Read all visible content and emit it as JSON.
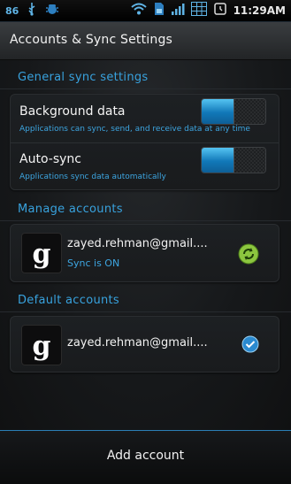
{
  "status_bar": {
    "battery_level": "86",
    "time": "11:29AM",
    "icons": [
      "usb-icon",
      "bug-icon",
      "wifi-icon",
      "sim-icon",
      "signal-icon",
      "grid-icon",
      "alarm-icon"
    ]
  },
  "header": {
    "title": "Accounts & Sync Settings"
  },
  "general": {
    "heading": "General sync settings",
    "background_data": {
      "title": "Background data",
      "subtitle": "Applications can sync, send, and receive data at any time",
      "enabled": true
    },
    "auto_sync": {
      "title": "Auto-sync",
      "subtitle": "Applications sync data automatically",
      "enabled": true
    }
  },
  "manage": {
    "heading": "Manage accounts",
    "account": {
      "email": "zayed.rehman@gmail....",
      "status": "Sync is ON"
    }
  },
  "defaults": {
    "heading": "Default accounts",
    "account": {
      "email": "zayed.rehman@gmail...."
    }
  },
  "footer": {
    "add_account": "Add account"
  },
  "colors": {
    "accent": "#38a2de",
    "sync_green": "#8cc63f"
  }
}
